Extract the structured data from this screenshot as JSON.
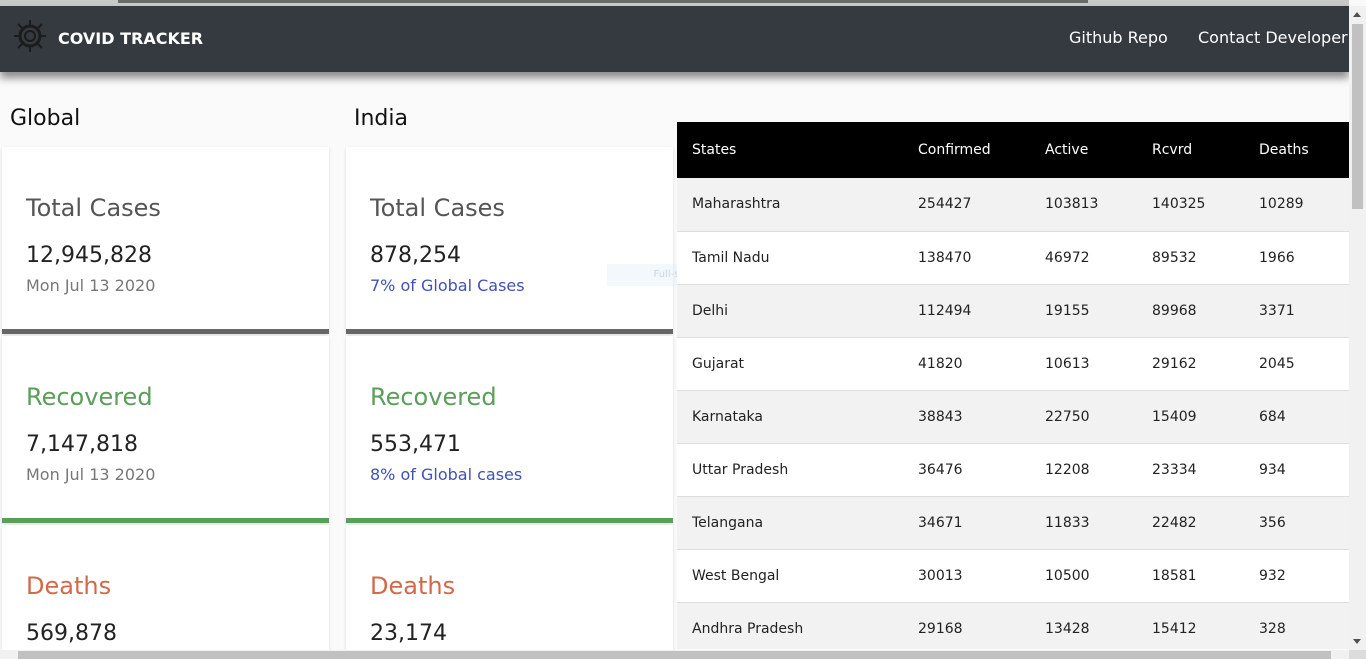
{
  "navbar": {
    "brand": "COVID TRACKER",
    "links": [
      "Github Repo",
      "Contact Developer"
    ],
    "logo_icon": "virus-icon"
  },
  "global": {
    "title": "Global",
    "cards": [
      {
        "title": "Total Cases",
        "value": "12,945,828",
        "sub": "Mon Jul 13 2020"
      },
      {
        "title": "Recovered",
        "value": "7,147,818",
        "sub": "Mon Jul 13 2020"
      },
      {
        "title": "Deaths",
        "value": "569,878"
      }
    ]
  },
  "india": {
    "title": "India",
    "cards": [
      {
        "title": "Total Cases",
        "value": "878,254",
        "sub": "7% of Global Cases"
      },
      {
        "title": "Recovered",
        "value": "553,471",
        "sub": "8% of Global cases"
      },
      {
        "title": "Deaths",
        "value": "23,174"
      }
    ]
  },
  "table": {
    "headers": [
      "States",
      "Confirmed",
      "Active",
      "Rcvrd",
      "Deaths"
    ],
    "rows": [
      [
        "Maharashtra",
        "254427",
        "103813",
        "140325",
        "10289"
      ],
      [
        "Tamil Nadu",
        "138470",
        "46972",
        "89532",
        "1966"
      ],
      [
        "Delhi",
        "112494",
        "19155",
        "89968",
        "3371"
      ],
      [
        "Gujarat",
        "41820",
        "10613",
        "29162",
        "2045"
      ],
      [
        "Karnataka",
        "38843",
        "22750",
        "15409",
        "684"
      ],
      [
        "Uttar Pradesh",
        "36476",
        "12208",
        "23334",
        "934"
      ],
      [
        "Telangana",
        "34671",
        "11833",
        "22482",
        "356"
      ],
      [
        "West Bengal",
        "30013",
        "10500",
        "18581",
        "932"
      ],
      [
        "Andhra Pradesh",
        "29168",
        "13428",
        "15412",
        "328"
      ]
    ]
  },
  "overlay": {
    "snip_text": "Full-screen Snip"
  },
  "colors": {
    "navbar": "#343a40",
    "total": "#555555",
    "recovered": "#5a9e5a",
    "deaths": "#d2694a",
    "link": "#3f51b5"
  }
}
